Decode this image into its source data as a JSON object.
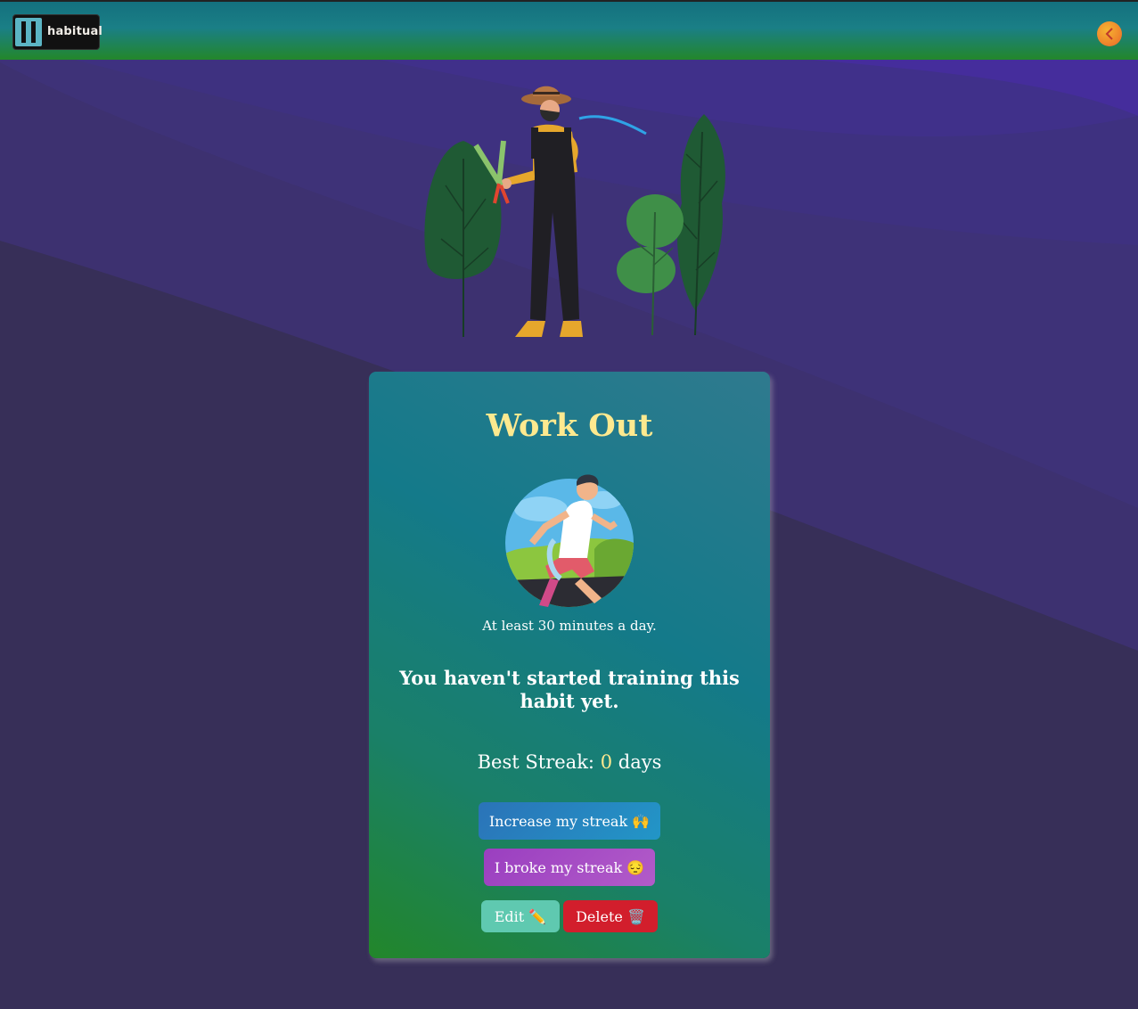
{
  "header": {
    "logo_text": "habitual"
  },
  "habit": {
    "title": "Work Out",
    "description": "At least 30 minutes a day.",
    "status": "You haven't started training this habit yet.",
    "streak_label": "Best Streak:",
    "streak_value": "0",
    "streak_unit": "days"
  },
  "actions": {
    "increase_label": "Increase my streak 🙌",
    "broke_label": "I broke my streak 😔",
    "edit_label": "Edit ✏️",
    "delete_label": "Delete 🗑️"
  },
  "icons": {
    "back": "chevron-left-icon"
  },
  "colors": {
    "background": "#372f58",
    "title": "#fde98f",
    "increase": "#2296c7",
    "broke": "#b25bc9",
    "edit": "#5fc9b0",
    "delete": "#d21e2c"
  }
}
